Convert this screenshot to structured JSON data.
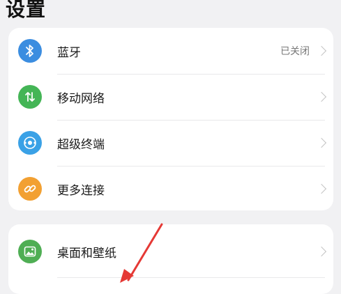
{
  "page": {
    "title": "设置"
  },
  "group1": {
    "items": [
      {
        "label": "蓝牙",
        "value": "已关闭",
        "icon": "bluetooth-icon",
        "color": "#3b8de0"
      },
      {
        "label": "移动网络",
        "icon": "mobile-network-icon",
        "color": "#44b556"
      },
      {
        "label": "超级终端",
        "icon": "super-device-icon",
        "color": "#3aa1e6"
      },
      {
        "label": "更多连接",
        "icon": "link-icon",
        "color": "#f2a032"
      }
    ]
  },
  "group2": {
    "items": [
      {
        "label": "桌面和壁纸",
        "icon": "wallpaper-icon",
        "color": "#4fae54"
      }
    ]
  },
  "annotation": {
    "color": "#e53935",
    "icon": "red-arrow-annotation"
  }
}
